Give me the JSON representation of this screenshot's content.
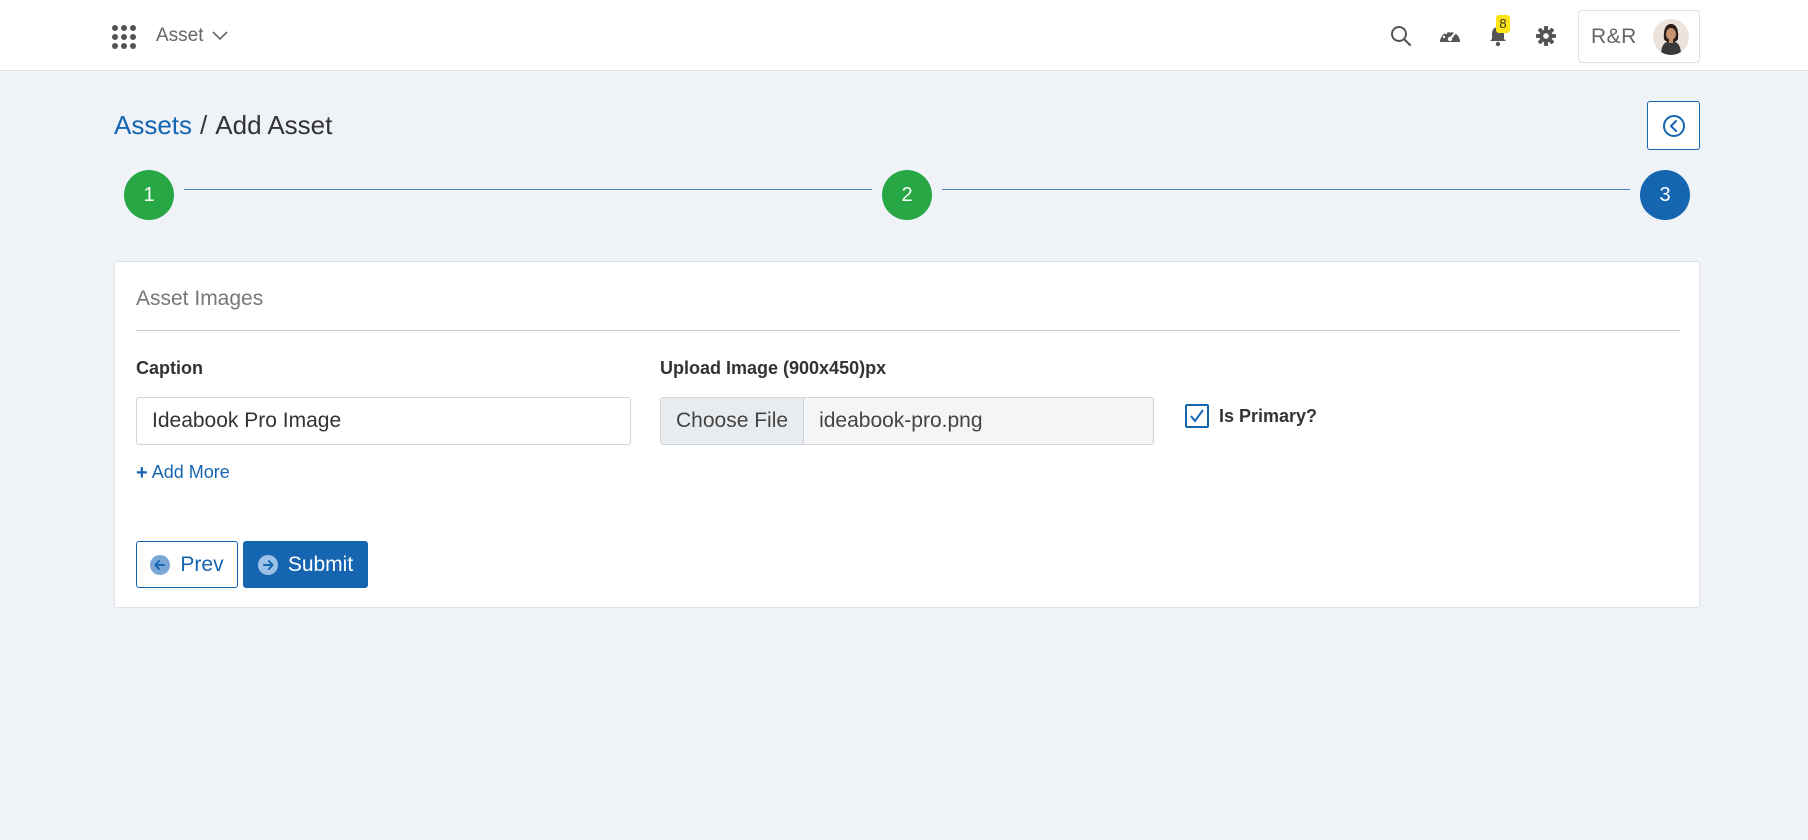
{
  "header": {
    "app_name": "Asset",
    "notification_count": "8",
    "user_name": "R&R",
    "icons": [
      "apps-grid-icon",
      "chevron-down-icon",
      "search-icon",
      "dashboard-icon",
      "bell-icon",
      "gear-icon"
    ]
  },
  "breadcrumb": {
    "parent": "Assets",
    "separator": "/",
    "current": "Add Asset"
  },
  "stepper": {
    "steps": [
      {
        "label": "1",
        "state": "done"
      },
      {
        "label": "2",
        "state": "done"
      },
      {
        "label": "3",
        "state": "active"
      }
    ],
    "colors": {
      "done": "#28a745",
      "active": "#1565b0"
    }
  },
  "form": {
    "section_title": "Asset Images",
    "caption_label": "Caption",
    "caption_value": "Ideabook Pro Image",
    "upload_label": "Upload Image (900x450)px",
    "file_button_label": "Choose File",
    "file_name": "ideabook-pro.png",
    "is_primary_label": "Is Primary?",
    "is_primary_checked": true,
    "add_more_label": "Add More"
  },
  "actions": {
    "prev_label": "Prev",
    "submit_label": "Submit"
  },
  "theme": {
    "accent": "#1565b0",
    "success": "#28a745",
    "background": "#eff3f8",
    "badge": "#ffe414"
  }
}
